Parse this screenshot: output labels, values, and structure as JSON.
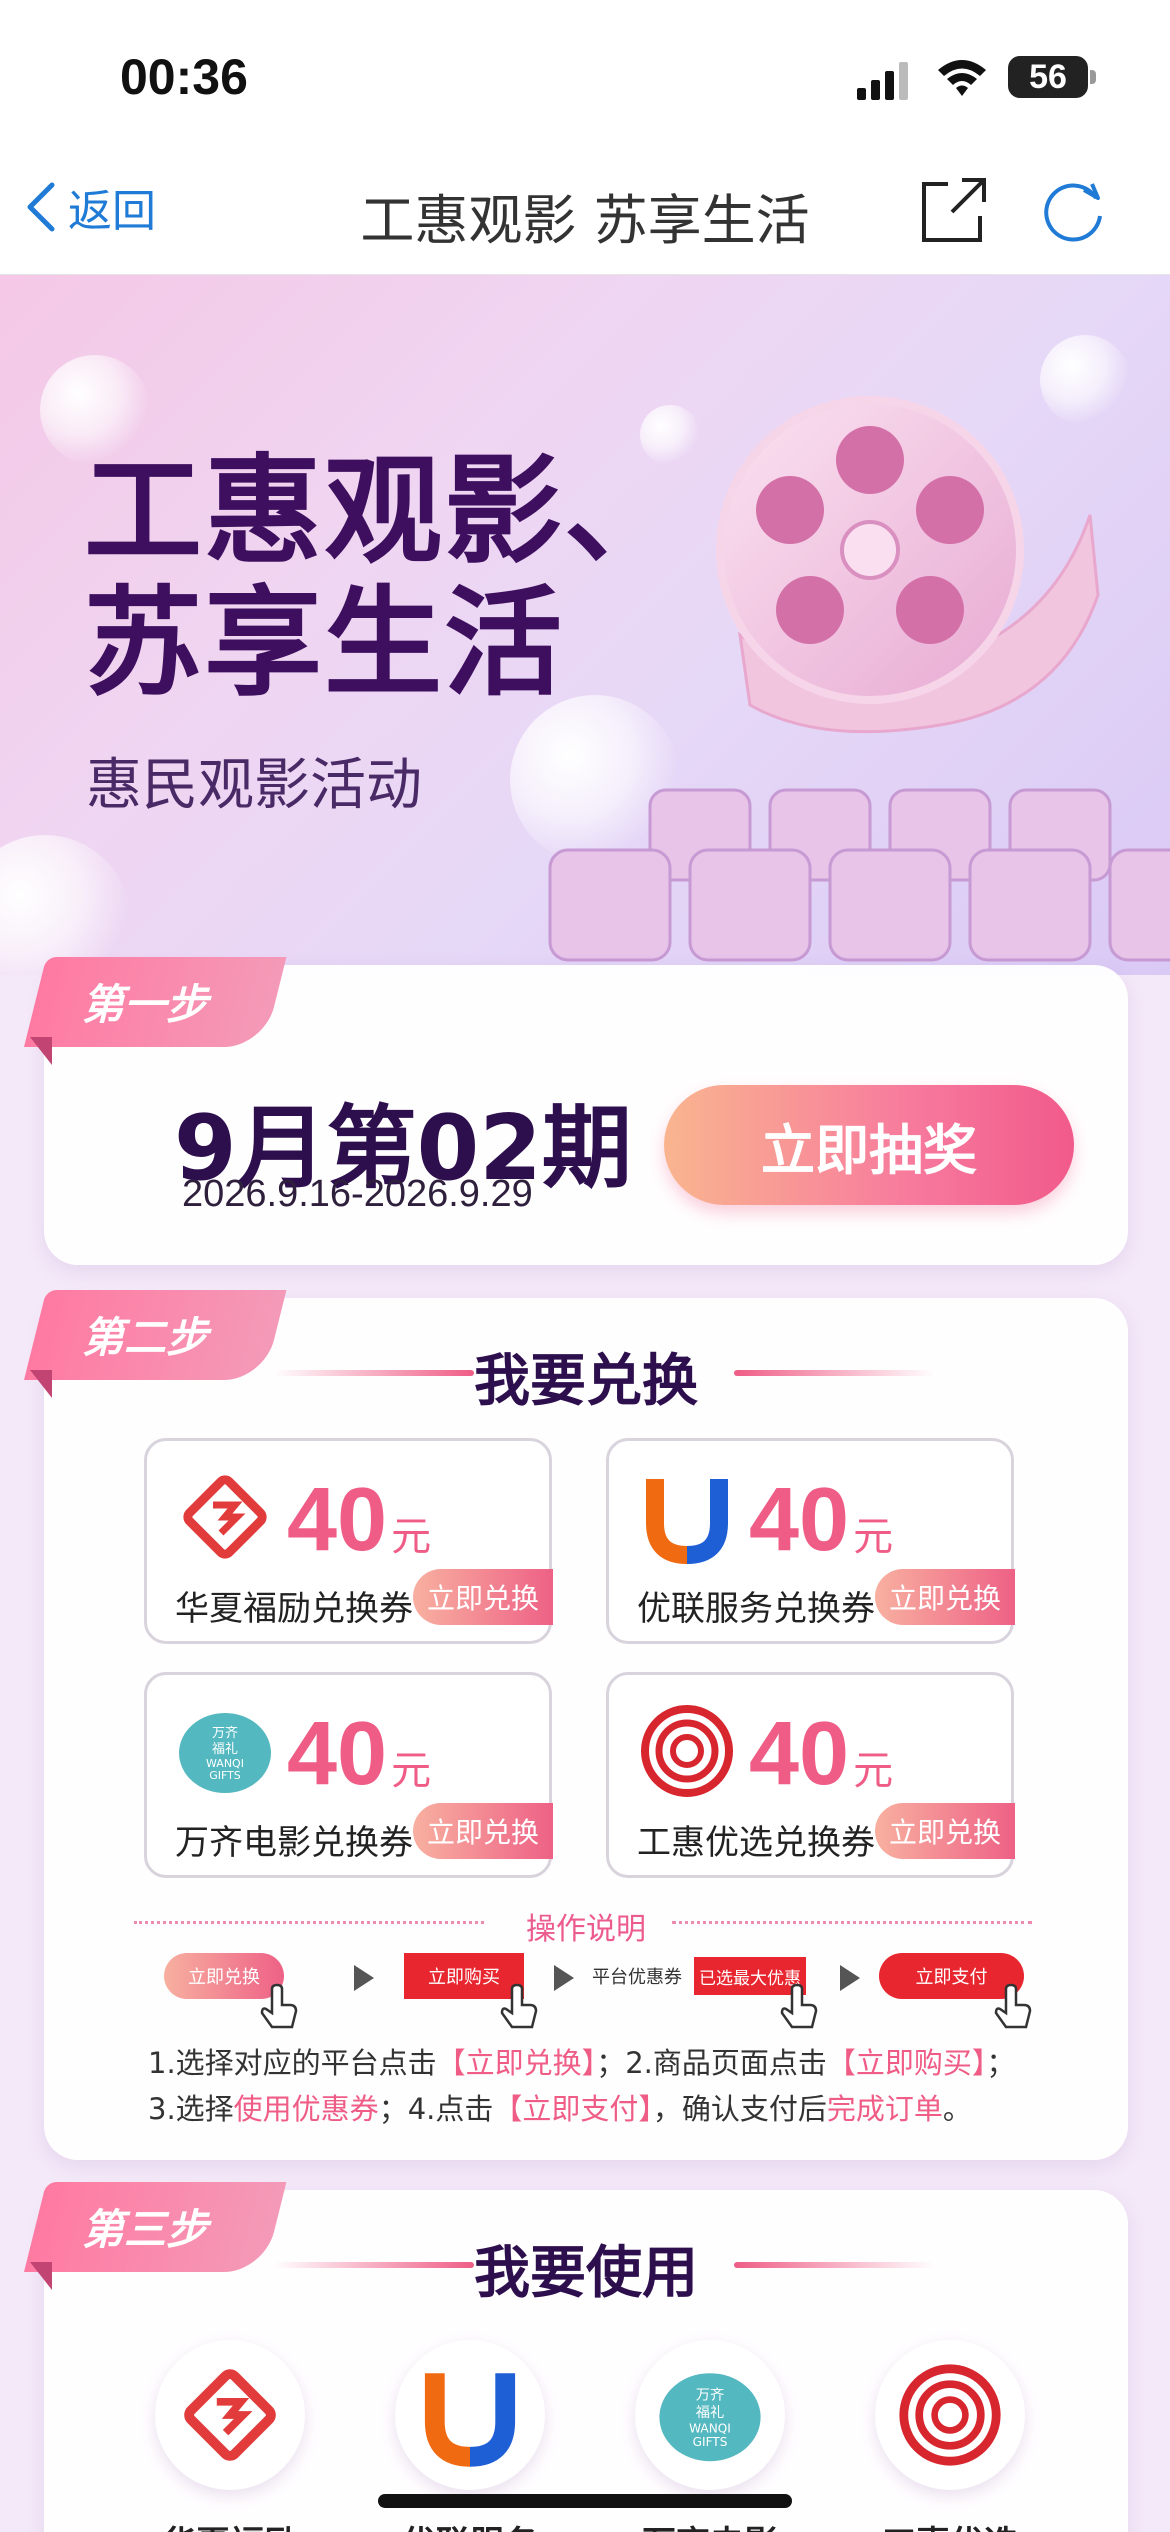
{
  "status_bar": {
    "time": "00:36",
    "battery": "56"
  },
  "nav": {
    "back_label": "返回",
    "title": "工惠观影 苏享生活"
  },
  "hero": {
    "title_line1": "工惠观影、",
    "title_line2": "苏享生活",
    "subtitle": "惠民观影活动"
  },
  "step1": {
    "badge": "第一步",
    "period": "9月第02期",
    "date_range": "2026.9.16-2026.9.29",
    "draw_button": "立即抽奖"
  },
  "step2": {
    "badge": "第二步",
    "title": "我要兑换",
    "coupons": [
      {
        "amount": "40",
        "unit": "元",
        "name": "华夏福励兑换券",
        "button": "立即兑换",
        "icon": "huaxia-logo-icon"
      },
      {
        "amount": "40",
        "unit": "元",
        "name": "优联服务兑换券",
        "button": "立即兑换",
        "icon": "youlian-logo-icon"
      },
      {
        "amount": "40",
        "unit": "元",
        "name": "万齐电影兑换券",
        "button": "立即兑换",
        "icon": "wanqi-logo-icon",
        "logo_text": [
          "万齐",
          "福礼",
          "WANQI",
          "GIFTS"
        ]
      },
      {
        "amount": "40",
        "unit": "元",
        "name": "工惠优选兑换券",
        "button": "立即兑换",
        "icon": "gonghui-logo-icon"
      }
    ],
    "ops_title": "操作说明",
    "ops_steps": {
      "redeem": "立即兑换",
      "buy": "立即购买",
      "coupon_label": "平台优惠券",
      "best_coupon": "已选最大优惠",
      "pay": "立即支付"
    },
    "instructions": {
      "l1_a": "1.选择对应的平台点击",
      "l1_b": "【立即兑换】",
      "l1_c": "；2.商品页面点击",
      "l1_d": "【立即购买】",
      "l1_e": "；",
      "l2_a": "3.选择",
      "l2_b": "使用优惠券",
      "l2_c": "；4.点击",
      "l2_d": "【立即支付】",
      "l2_e": "，确认支付后",
      "l2_f": "完成订单",
      "l2_g": "。"
    }
  },
  "step3": {
    "badge": "第三步",
    "title": "我要使用",
    "apps": [
      {
        "label": "华夏福励"
      },
      {
        "label": "优联服务"
      },
      {
        "label": "万齐电影"
      },
      {
        "label": "工惠优选"
      }
    ]
  },
  "colors": {
    "accent_pink": "#ef5d86",
    "deep_purple": "#2e0f4e",
    "link_blue": "#1f7bd6"
  }
}
